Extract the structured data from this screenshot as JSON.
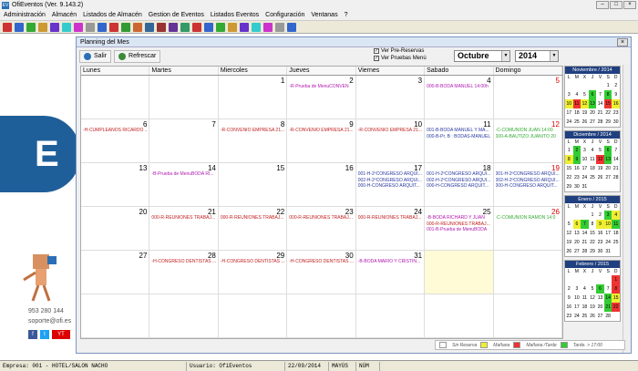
{
  "app": {
    "title": "OfiEventos (Ver. 9.143.2)"
  },
  "menu": [
    "Administración",
    "Almacén",
    "Listados de Almacén",
    "Gestion de Eventos",
    "Listados Eventos",
    "Configuración",
    "Ventanas",
    "?"
  ],
  "desktop": {
    "logo_text": "E",
    "phone": "953 280 144",
    "web": "soporte@ofi.es"
  },
  "planning": {
    "title": "Planning del Mes",
    "salir": "Salir",
    "refrescar": "Refrescar",
    "pre_reservas": "Ver Pre-Reservas",
    "pruebas_menu": "Ver Pruebas Menú",
    "month": "Octubre",
    "year": "2014",
    "days": [
      "Lunes",
      "Martes",
      "Miercoles",
      "Jueves",
      "Viernes",
      "Sabado",
      "Domingo"
    ],
    "weeks": [
      [
        {
          "n": "",
          "e": []
        },
        {
          "n": "",
          "e": []
        },
        {
          "n": "1",
          "e": []
        },
        {
          "n": "2",
          "e": [
            "-R-Prueba de MenuCONVEN"
          ]
        },
        {
          "n": "3",
          "e": []
        },
        {
          "n": "4",
          "e": [
            "000-B-BODA MANUEL 14:00h"
          ]
        },
        {
          "n": "5",
          "red": true,
          "e": []
        }
      ],
      [
        {
          "n": "6",
          "e": [
            "-H-CUMPLEAÑOS RICARDO ..."
          ]
        },
        {
          "n": "7",
          "e": []
        },
        {
          "n": "8",
          "e": [
            "-R-CONVENIO EMPRESA 21..."
          ]
        },
        {
          "n": "9",
          "e": [
            "-R-CONVENIO EMPRESA 21..."
          ]
        },
        {
          "n": "10",
          "e": [
            "-R-CONVENIO EMPRESA 21..."
          ]
        },
        {
          "n": "11",
          "e": [
            "001-B-BODA MANUEL Y MA...",
            "000-B-Pr. B : BODAS-MANUEL"
          ]
        },
        {
          "n": "12",
          "red": true,
          "e": [
            "-C-COMUNION JUAN 14:00",
            "000-A-BAUTIZO JUANITO 20"
          ]
        }
      ],
      [
        {
          "n": "13",
          "e": []
        },
        {
          "n": "14",
          "e": [
            "-B-Prueba de MenuBODA RI..."
          ]
        },
        {
          "n": "15",
          "e": []
        },
        {
          "n": "16",
          "e": []
        },
        {
          "n": "17",
          "e": [
            "001-H-2ºCONGRESO ARQUI...",
            "002-H-2ºCONGRESO ARQUI...",
            "000-H-CONGRESO ARQUIT..."
          ]
        },
        {
          "n": "18",
          "e": [
            "001-H-2ºCONGRESO ARQUI...",
            "002-H-2ºCONGRESO ARQUI...",
            "000-H-CONGRESO ARQUIT..."
          ]
        },
        {
          "n": "19",
          "red": true,
          "e": [
            "001-H-2ºCONGRESO ARQUI...",
            "002-H-2ºCONGRESO ARQUI...",
            "000-H-CONGRESO ARQUIT..."
          ]
        }
      ],
      [
        {
          "n": "20",
          "e": []
        },
        {
          "n": "21",
          "e": [
            "000-R-REUNIONES TRABAJ..."
          ]
        },
        {
          "n": "22",
          "e": [
            "000-R-REUNIONES TRABAJ..."
          ]
        },
        {
          "n": "23",
          "e": [
            "000-R-REUNIONES TRABAJ..."
          ]
        },
        {
          "n": "24",
          "e": [
            "000-R-REUNIONES TRABAJ..."
          ]
        },
        {
          "n": "25",
          "e": [
            "-B-BODA RICHARD Y JUAN",
            "000-R-REUNIONES TRABAJ...",
            "001-B-Prueba de MenuBODA"
          ]
        },
        {
          "n": "26",
          "red": true,
          "e": [
            "-C-COMUNION RAMON 14:0"
          ]
        }
      ],
      [
        {
          "n": "27",
          "e": []
        },
        {
          "n": "28",
          "e": [
            "-H-CONGRESO DENTISTAS ..."
          ]
        },
        {
          "n": "29",
          "e": [
            "-H-CONGRESO DENTISTAS ..."
          ]
        },
        {
          "n": "30",
          "e": [
            "-H-CONGRESO DENTISTAS ..."
          ]
        },
        {
          "n": "31",
          "e": [
            "-B-BODA MARIO Y CRISTIN..."
          ]
        },
        {
          "n": "",
          "hl": true,
          "e": []
        },
        {
          "n": "",
          "e": []
        }
      ],
      [
        {
          "n": "",
          "e": []
        },
        {
          "n": "",
          "e": []
        },
        {
          "n": "",
          "e": []
        },
        {
          "n": "",
          "e": []
        },
        {
          "n": "",
          "e": []
        },
        {
          "n": "",
          "e": []
        },
        {
          "n": "",
          "e": []
        }
      ]
    ],
    "legend": [
      "Sin Reserva",
      "Mañana",
      "Mañana /Tarde",
      "Tarde. > 17:00"
    ]
  },
  "minis": [
    {
      "title": "Noviembre / 2014",
      "rows": [
        [
          "",
          "",
          "",
          "",
          "",
          "1",
          "2"
        ],
        [
          "3",
          "4",
          "5",
          "6",
          "7",
          "8",
          "9"
        ],
        [
          "10",
          "11",
          "12",
          "13",
          "14",
          "15",
          "16"
        ],
        [
          "17",
          "18",
          "19",
          "20",
          "21",
          "22",
          "23"
        ],
        [
          "24",
          "25",
          "26",
          "27",
          "28",
          "29",
          "30"
        ]
      ],
      "colors": {
        "6": "#3c3",
        "8": "#3c3",
        "10": "#ee3",
        "11": "#e33",
        "12": "#ee3",
        "13": "#3c3",
        "15": "#e33",
        "16": "#ee3"
      }
    },
    {
      "title": "Diciembre / 2014",
      "rows": [
        [
          "1",
          "2",
          "3",
          "4",
          "5",
          "6",
          "7"
        ],
        [
          "8",
          "9",
          "10",
          "11",
          "12",
          "13",
          "14"
        ],
        [
          "15",
          "16",
          "17",
          "18",
          "19",
          "20",
          "21"
        ],
        [
          "22",
          "23",
          "24",
          "25",
          "26",
          "27",
          "28"
        ],
        [
          "29",
          "30",
          "31",
          "",
          "",
          "",
          ""
        ]
      ],
      "colors": {
        "2": "#3c3",
        "6": "#3c3",
        "8": "#ee3",
        "9": "#3c3",
        "12": "#e33",
        "13": "#3c3"
      }
    },
    {
      "title": "Enero / 2015",
      "rows": [
        [
          "",
          "",
          "",
          "1",
          "2",
          "3",
          "4"
        ],
        [
          "5",
          "6",
          "7",
          "8",
          "9",
          "10",
          "11"
        ],
        [
          "12",
          "13",
          "14",
          "15",
          "16",
          "17",
          "18"
        ],
        [
          "19",
          "20",
          "21",
          "22",
          "23",
          "24",
          "25"
        ],
        [
          "26",
          "27",
          "28",
          "29",
          "30",
          "31",
          ""
        ]
      ],
      "colors": {
        "3": "#3c3",
        "4": "#ee3",
        "6": "#ee3",
        "7": "#3c3",
        "9": "#ee3",
        "10": "#ee3",
        "11": "#3c3"
      }
    },
    {
      "title": "Febrero / 2015",
      "rows": [
        [
          "",
          "",
          "",
          "",
          "",
          "",
          "1"
        ],
        [
          "2",
          "3",
          "4",
          "5",
          "6",
          "7",
          "8"
        ],
        [
          "9",
          "10",
          "11",
          "12",
          "13",
          "14",
          "15"
        ],
        [
          "16",
          "17",
          "18",
          "19",
          "20",
          "21",
          "22"
        ],
        [
          "23",
          "24",
          "25",
          "26",
          "27",
          "28",
          ""
        ]
      ],
      "colors": {
        "1": "#e33",
        "6": "#3c3",
        "8": "#e33",
        "14": "#3c3",
        "15": "#ee3",
        "21": "#3c3",
        "22": "#e33"
      }
    }
  ],
  "mini_days": [
    "L",
    "M",
    "X",
    "J",
    "V",
    "S",
    "D"
  ],
  "status": {
    "empresa": "Empresa: 001 - HOTEL/SALON NACHO",
    "usuario": "Usuario: OfiEventos",
    "fecha": "22/09/2014",
    "mayus": "MAYÚS",
    "num": "NÚM"
  }
}
